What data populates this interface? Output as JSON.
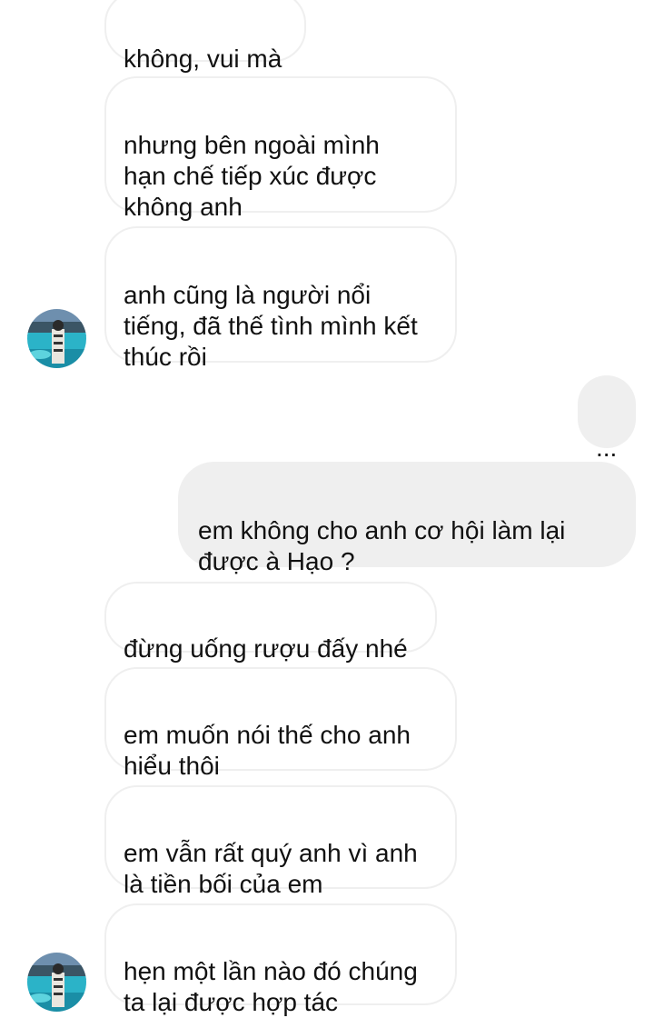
{
  "messages": [
    {
      "side": "received",
      "text": "không, vui mà"
    },
    {
      "side": "received",
      "text": "nhưng bên ngoài mình\nhạn chế tiếp xúc được\nkhông anh"
    },
    {
      "side": "received",
      "text": "anh cũng là người nổi\ntiếng, đã thế tình mình kết\nthúc rồi"
    },
    {
      "side": "sent",
      "text": "..."
    },
    {
      "side": "sent",
      "text": "em không cho anh cơ hội làm lại\nđược à Hạo ?"
    },
    {
      "side": "received",
      "text": "đừng uống rượu đấy nhé"
    },
    {
      "side": "received",
      "text": "em muốn nói thế cho anh\nhiểu thôi"
    },
    {
      "side": "received",
      "text": "em vẫn rất quý anh vì anh\nlà tiền bối của em"
    },
    {
      "side": "received",
      "text": "hẹn một lần nào đó chúng\nta lại được hợp tác"
    }
  ],
  "colors": {
    "sent_bubble": "#efefef",
    "received_border": "#efefef",
    "text": "#111111",
    "background": "#ffffff"
  },
  "avatar": {
    "icon": "profile-photo-lake"
  }
}
